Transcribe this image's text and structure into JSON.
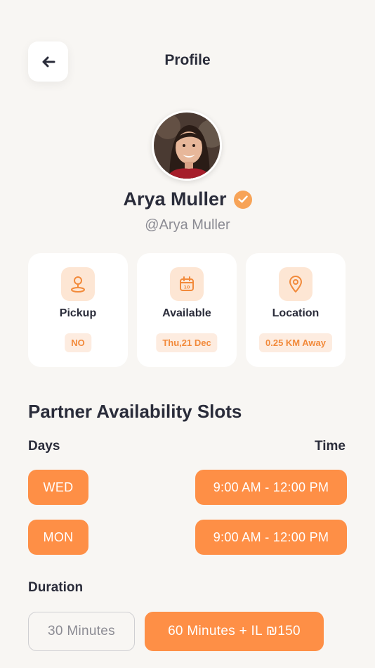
{
  "header": {
    "title": "Profile"
  },
  "profile": {
    "name": "Arya Muller",
    "handle": "@Arya Muller"
  },
  "cards": [
    {
      "label": "Pickup",
      "value": "NO",
      "icon": "pickup-pin-icon"
    },
    {
      "label": "Available",
      "value": "Thu,21 Dec",
      "icon": "calendar-icon"
    },
    {
      "label": "Location",
      "value": "0.25 KM Away",
      "icon": "location-pin-icon"
    }
  ],
  "slots": {
    "title": "Partner Availability Slots",
    "days_label": "Days",
    "time_label": "Time",
    "rows": [
      {
        "day": "WED",
        "time": "9:00 AM -  12:00 PM"
      },
      {
        "day": "MON",
        "time": "9:00 AM -  12:00 PM"
      }
    ]
  },
  "duration": {
    "label": "Duration",
    "options": [
      {
        "text": "30 Minutes",
        "selected": false
      },
      {
        "text": "60 Minutes + IL ₪150",
        "selected": true
      }
    ]
  },
  "colors": {
    "accent": "#fe8f46",
    "accent_light": "#fde6d4",
    "text": "#2a2c3a",
    "muted": "#8b8b93",
    "background": "#f8f6f3"
  }
}
